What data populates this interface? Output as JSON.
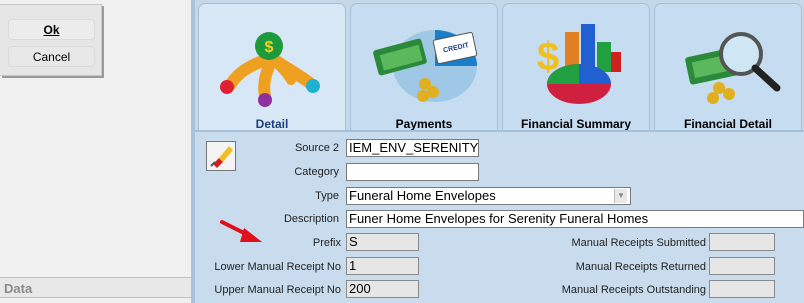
{
  "buttons": {
    "ok": "Ok",
    "cancel": "Cancel"
  },
  "left_panel": {
    "data_header": "Data"
  },
  "tabs": [
    {
      "label": "Detail",
      "icon": "detail-icon"
    },
    {
      "label": "Payments",
      "icon": "payments-icon"
    },
    {
      "label": "Financial Summary",
      "icon": "financial-summary-icon"
    },
    {
      "label": "Financial Detail",
      "icon": "financial-detail-icon"
    }
  ],
  "form": {
    "source2": {
      "label": "Source 2",
      "value": "IEM_ENV_SERENITY"
    },
    "category": {
      "label": "Category",
      "value": ""
    },
    "type": {
      "label": "Type",
      "value": "Funeral Home Envelopes"
    },
    "description": {
      "label": "Description",
      "value": "Funer Home Envelopes for Serenity Funeral Homes"
    },
    "prefix": {
      "label": "Prefix",
      "value": "S"
    },
    "lower_receipt": {
      "label": "Lower Manual Receipt No",
      "value": "1"
    },
    "upper_receipt": {
      "label": "Upper Manual Receipt No",
      "value": "200"
    },
    "submitted": {
      "label": "Manual Receipts Submitted",
      "value": ""
    },
    "returned": {
      "label": "Manual Receipts Returned",
      "value": ""
    },
    "outstanding": {
      "label": "Manual Receipts Outstanding",
      "value": ""
    }
  },
  "colors": {
    "tab_label_active": "#1f3f7a",
    "arrow": "#e0101a"
  }
}
